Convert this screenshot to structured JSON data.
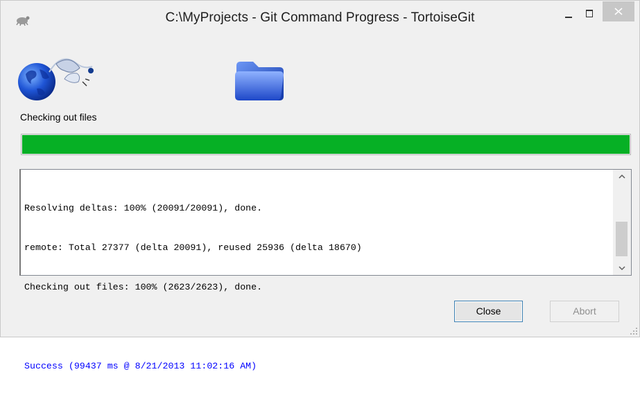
{
  "window": {
    "title": "C:\\MyProjects - Git Command Progress - TortoiseGit",
    "minimize_icon": "minimize-icon",
    "maximize_icon": "maximize-icon",
    "close_icon": "close-icon"
  },
  "animation": {
    "source_icon": "globe-icon",
    "target_icon": "folder-icon"
  },
  "status": {
    "label": "Checking out files",
    "progress_percent": 100,
    "progress_color": "#06b025"
  },
  "log": {
    "lines": [
      "Resolving deltas: 100% (20091/20091), done.",
      "remote: Total 27377 (delta 20091), reused 25936 (delta 18670)",
      "Checking out files: 100% (2623/2623), done."
    ],
    "success_line": "Success (99437 ms @ 8/21/2013 11:02:16 AM)",
    "success_color": "#0000ff"
  },
  "buttons": {
    "close_label": "Close",
    "abort_label": "Abort"
  }
}
